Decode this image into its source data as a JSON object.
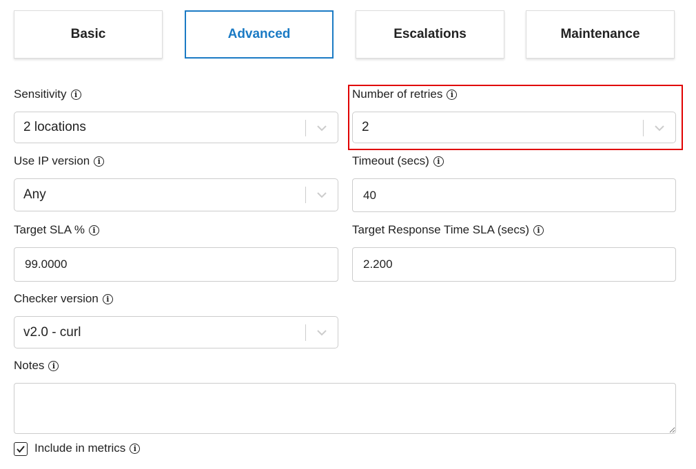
{
  "tabs": [
    {
      "label": "Basic",
      "active": false
    },
    {
      "label": "Advanced",
      "active": true
    },
    {
      "label": "Escalations",
      "active": false
    },
    {
      "label": "Maintenance",
      "active": false
    }
  ],
  "fields": {
    "sensitivity": {
      "label": "Sensitivity",
      "value": "2 locations",
      "icon": "info-icon"
    },
    "retries": {
      "label": "Number of retries",
      "value": "2",
      "icon": "info-icon"
    },
    "ip_version": {
      "label": "Use IP version",
      "value": "Any",
      "icon": "info-icon"
    },
    "timeout": {
      "label": "Timeout (secs)",
      "value": "40",
      "icon": "info-icon"
    },
    "target_sla": {
      "label": "Target SLA %",
      "value": "99.0000",
      "icon": "info-icon"
    },
    "response_sla": {
      "label": "Target Response Time SLA (secs)",
      "value": "2.200",
      "icon": "info-icon"
    },
    "checker_version": {
      "label": "Checker version",
      "value": "v2.0 - curl",
      "icon": "info-icon"
    },
    "notes": {
      "label": "Notes",
      "value": "",
      "icon": "info-icon"
    },
    "include_metrics": {
      "label": "Include in metrics",
      "checked": true,
      "icon": "info-icon"
    }
  },
  "colors": {
    "accent": "#1a7ac4",
    "highlight": "#e00000"
  }
}
